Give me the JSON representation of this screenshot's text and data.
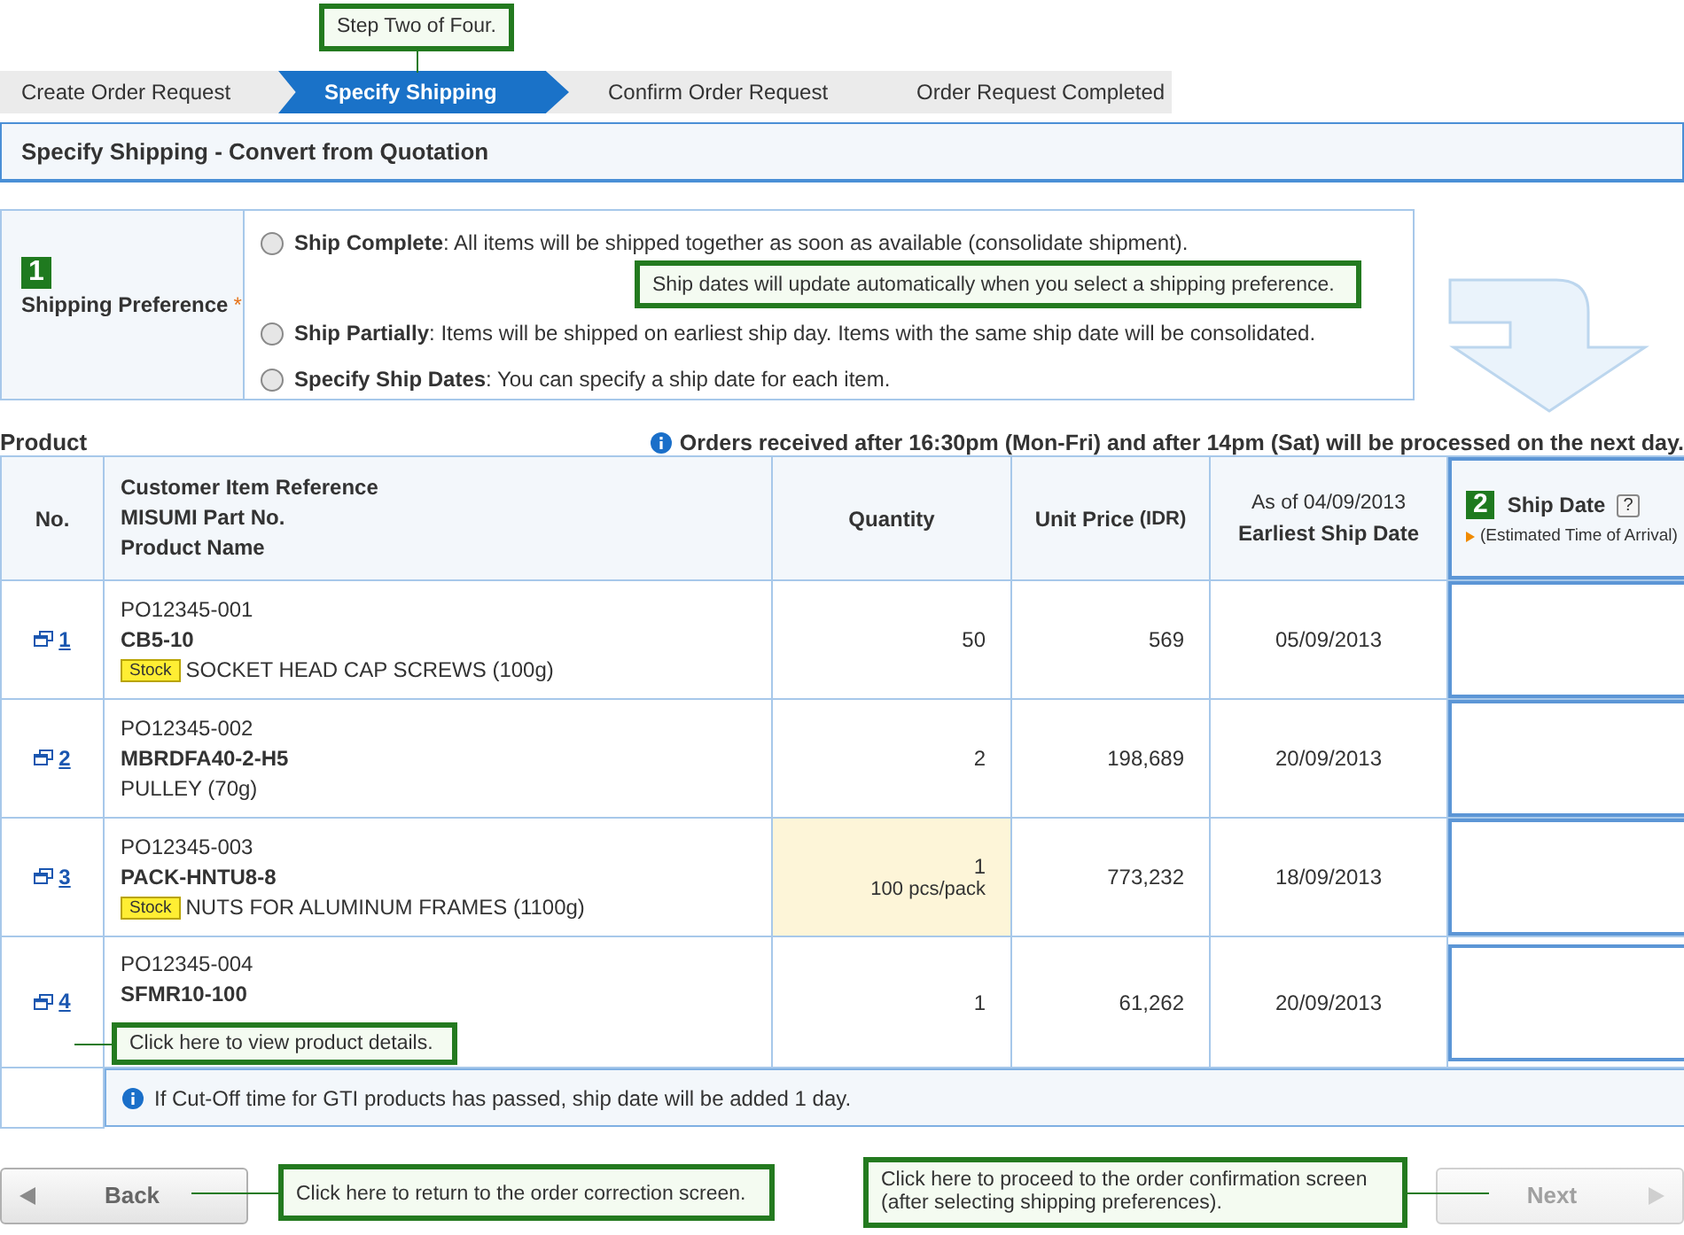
{
  "steps": [
    {
      "label": "Create Order Request",
      "selected": false
    },
    {
      "label": "Specify Shipping",
      "selected": true
    },
    {
      "label": "Confirm Order Request",
      "selected": false
    },
    {
      "label": "Order Request Completed",
      "selected": false
    }
  ],
  "page_title": "Specify Shipping - Convert from Quotation",
  "shipping_preference": {
    "badge": "1",
    "label": "Shipping Preference",
    "required_mark": "*",
    "options": [
      {
        "title": "Ship Complete",
        "text": ": All items will be shipped together as soon as available (consolidate shipment).",
        "selected": false
      },
      {
        "title": "Ship Partially",
        "text": ": Items will be shipped on earliest ship day. Items with the same ship date will be consolidated.",
        "selected": false
      },
      {
        "title": "Specify Ship Dates",
        "text": ": You can specify a ship date for each item.",
        "selected": false
      }
    ]
  },
  "product_heading": "Product",
  "notice": "Orders received after 16:30pm (Mon-Fri) and after 14pm (Sat) will be processed on the next day.",
  "table": {
    "columns": {
      "no": "No.",
      "description": [
        "Customer Item Reference",
        "MISUMI Part No.",
        "Product Name"
      ],
      "quantity": "Quantity",
      "unit_price": "Unit Price",
      "currency": "(IDR)",
      "as_of": "As of 04/09/2013",
      "earliest": "Earliest Ship Date",
      "ship_badge": "2",
      "ship_date": "Ship Date",
      "help": "?",
      "ship_note": "(Estimated Time of Arrival)"
    },
    "rows": [
      {
        "no": "1",
        "reference": "PO12345-001",
        "part_no": "CB5-10",
        "stock_tag": "Stock",
        "product_name": "SOCKET HEAD CAP SCREWS (100g)",
        "quantity": "50",
        "highlighted": false,
        "unit_price": "569",
        "earliest": "05/09/2013"
      },
      {
        "no": "2",
        "reference": "PO12345-002",
        "part_no": "MBRDFA40-2-H5",
        "product_name": "PULLEY (70g)",
        "quantity": "2",
        "highlighted": false,
        "unit_price": "198,689",
        "earliest": "20/09/2013"
      },
      {
        "no": "3",
        "reference": "PO12345-003",
        "part_no": "PACK-HNTU8-8",
        "stock_tag": "Stock",
        "product_name": "NUTS FOR ALUMINUM FRAMES (1100g)",
        "quantity": "1",
        "pack_note": "100 pcs/pack",
        "highlighted": true,
        "unit_price": "773,232",
        "earliest": "18/09/2013"
      },
      {
        "no": "4",
        "reference": "PO12345-004",
        "part_no": "SFMR10-100",
        "quantity": "1",
        "highlighted": false,
        "unit_price": "61,262",
        "earliest": "20/09/2013"
      }
    ],
    "footnote": "If Cut-Off time for GTI products has passed, ship date will be added 1 day."
  },
  "buttons": [
    {
      "label": "Back",
      "disabled": false
    },
    {
      "label": "Next",
      "disabled": true
    }
  ],
  "annotations": [
    {
      "text": "Step Two of Four."
    },
    {
      "text": "Ship dates will update automatically when you select a shipping preference."
    },
    {
      "text": "Click here to view product details."
    },
    {
      "text": "Click here to return to the order correction screen."
    },
    {
      "text": "Click here to proceed to the order confirmation screen (after selecting shipping preferences)."
    }
  ]
}
